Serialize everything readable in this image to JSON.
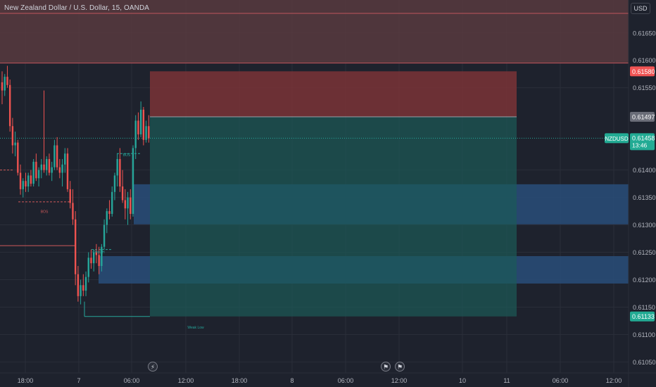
{
  "header": {
    "title": "New Zealand Dollar / U.S. Dollar, 15, OANDA",
    "currency_button": "USD"
  },
  "colors": {
    "background": "#1e222d",
    "up": "#26a69a",
    "down": "#ef5350",
    "stop_zone": "#7a3237",
    "target_zone": "#1b5a57",
    "demand_zone": "#2a4f7c",
    "supply_zone": "#5a3a40",
    "axis_text": "#b2b5be"
  },
  "chart_data": {
    "type": "candlestick",
    "symbol": "NZDUSD",
    "interval": "15",
    "source": "OANDA",
    "ylim": [
      0.6103,
      0.6171
    ],
    "y_ticks": [
      "0.61650",
      "0.61600",
      "0.61550",
      "0.61400",
      "0.61350",
      "0.61300",
      "0.61250",
      "0.61200",
      "0.61150",
      "0.61100",
      "0.61050"
    ],
    "x_ticks": [
      "18:00",
      "7",
      "06:00",
      "12:00",
      "18:00",
      "8",
      "06:00",
      "12:00",
      "10",
      "11",
      "06:00",
      "12:00"
    ],
    "price_labels": [
      {
        "name": "stop",
        "text": "0.61580",
        "price": 0.6158,
        "color": "#f05454"
      },
      {
        "name": "entry",
        "text": "0.61497",
        "price": 0.61497,
        "color": "#6a6d78"
      },
      {
        "name": "current",
        "symbol": "NZDUSD",
        "text": "0.61458",
        "countdown": "13:46",
        "price": 0.61458,
        "color": "#22ab94"
      },
      {
        "name": "target",
        "text": "0.61133",
        "price": 0.61133,
        "color": "#22ab94"
      }
    ],
    "position_tool": {
      "entry": 0.61497,
      "stop": 0.6158,
      "target": 0.61133
    },
    "zones": [
      {
        "name": "supply-zone",
        "top": 0.6171,
        "bottom": 0.61595
      },
      {
        "name": "demand-zone-upper",
        "top": 0.61374,
        "bottom": 0.61301
      },
      {
        "name": "demand-zone-lower",
        "top": 0.61243,
        "bottom": 0.61193
      }
    ],
    "annotations": [
      {
        "text": "BOS",
        "price": 0.61336
      },
      {
        "text": "BOS",
        "price": 0.61439
      },
      {
        "text": "CHoCH",
        "price": 0.61262
      },
      {
        "text": "Weak Low",
        "price": 0.61125
      }
    ],
    "candles": [
      [
        0.6156,
        0.6158,
        0.6152,
        0.61545
      ],
      [
        0.61545,
        0.61575,
        0.61535,
        0.6157
      ],
      [
        0.6157,
        0.6159,
        0.6155,
        0.61555
      ],
      [
        0.61555,
        0.61565,
        0.6147,
        0.6148
      ],
      [
        0.6148,
        0.61495,
        0.6143,
        0.61445
      ],
      [
        0.61445,
        0.6147,
        0.61425,
        0.6145
      ],
      [
        0.6145,
        0.61455,
        0.6139,
        0.61395
      ],
      [
        0.61395,
        0.6141,
        0.61355,
        0.61365
      ],
      [
        0.61365,
        0.61385,
        0.6135,
        0.6138
      ],
      [
        0.6138,
        0.61395,
        0.6136,
        0.6137
      ],
      [
        0.6137,
        0.61395,
        0.6136,
        0.6139
      ],
      [
        0.6139,
        0.614,
        0.6137,
        0.61375
      ],
      [
        0.61375,
        0.6142,
        0.6137,
        0.61415
      ],
      [
        0.61415,
        0.6143,
        0.6138,
        0.61385
      ],
      [
        0.61385,
        0.61405,
        0.6137,
        0.614
      ],
      [
        0.614,
        0.6142,
        0.61385,
        0.6141
      ],
      [
        0.6141,
        0.61545,
        0.61395,
        0.614
      ],
      [
        0.614,
        0.61425,
        0.6139,
        0.6142
      ],
      [
        0.6142,
        0.6143,
        0.6139,
        0.61395
      ],
      [
        0.61395,
        0.61415,
        0.6138,
        0.61405
      ],
      [
        0.61405,
        0.61455,
        0.614,
        0.61445
      ],
      [
        0.61445,
        0.6146,
        0.614,
        0.61405
      ],
      [
        0.61405,
        0.6142,
        0.61385,
        0.61395
      ],
      [
        0.61395,
        0.6142,
        0.6137,
        0.6141
      ],
      [
        0.6141,
        0.6144,
        0.61395,
        0.6143
      ],
      [
        0.6143,
        0.6144,
        0.6136,
        0.61365
      ],
      [
        0.61365,
        0.6138,
        0.6133,
        0.6134
      ],
      [
        0.6134,
        0.61365,
        0.613,
        0.6131
      ],
      [
        0.6131,
        0.61325,
        0.6119,
        0.6121
      ],
      [
        0.6121,
        0.61225,
        0.6116,
        0.6117
      ],
      [
        0.6117,
        0.612,
        0.61155,
        0.6119
      ],
      [
        0.6119,
        0.6121,
        0.6117,
        0.6118
      ],
      [
        0.6118,
        0.61215,
        0.6117,
        0.61205
      ],
      [
        0.61205,
        0.6125,
        0.61195,
        0.6124
      ],
      [
        0.6124,
        0.61255,
        0.6122,
        0.6123
      ],
      [
        0.6123,
        0.61255,
        0.61215,
        0.6125
      ],
      [
        0.6125,
        0.61265,
        0.6123,
        0.61245
      ],
      [
        0.61245,
        0.6126,
        0.6121,
        0.61225
      ],
      [
        0.61225,
        0.61265,
        0.61215,
        0.6126
      ],
      [
        0.6126,
        0.6131,
        0.61255,
        0.613
      ],
      [
        0.613,
        0.6133,
        0.61285,
        0.61325
      ],
      [
        0.61325,
        0.61345,
        0.6131,
        0.6132
      ],
      [
        0.6132,
        0.6137,
        0.61315,
        0.6136
      ],
      [
        0.6136,
        0.61395,
        0.61345,
        0.6139
      ],
      [
        0.6139,
        0.6143,
        0.6137,
        0.6142
      ],
      [
        0.6142,
        0.6144,
        0.6136,
        0.6137
      ],
      [
        0.6137,
        0.614,
        0.6134,
        0.61345
      ],
      [
        0.61345,
        0.61365,
        0.6131,
        0.6133
      ],
      [
        0.6133,
        0.6136,
        0.613,
        0.6135
      ],
      [
        0.6135,
        0.61365,
        0.6131,
        0.6132
      ],
      [
        0.6132,
        0.61445,
        0.61315,
        0.6144
      ],
      [
        0.6144,
        0.615,
        0.6142,
        0.6149
      ],
      [
        0.6149,
        0.61505,
        0.61455,
        0.61465
      ],
      [
        0.61465,
        0.61525,
        0.6146,
        0.6151
      ],
      [
        0.6151,
        0.61515,
        0.61445,
        0.61455
      ],
      [
        0.61455,
        0.6149,
        0.6145,
        0.6148
      ],
      [
        0.6148,
        0.615,
        0.6145,
        0.61458
      ]
    ]
  }
}
